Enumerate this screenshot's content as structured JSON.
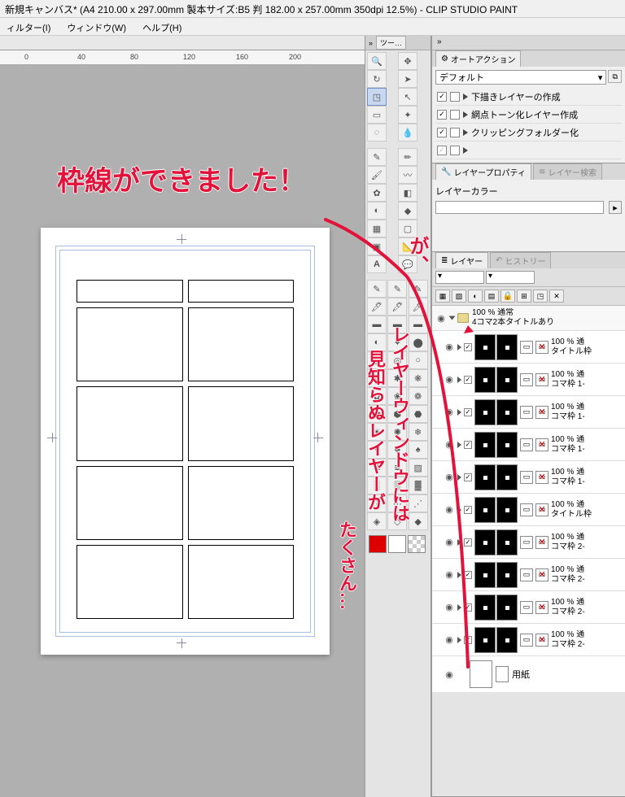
{
  "titlebar": "新規キャンバス* (A4 210.00 x 297.00mm 製本サイズ:B5 判 182.00 x 257.00mm 350dpi 12.5%)  - CLIP STUDIO PAINT",
  "menu": {
    "filter": "ィルター(I)",
    "window": "ウィンドウ(W)",
    "help": "ヘルプ(H)"
  },
  "ruler": [
    "0",
    "40",
    "80",
    "120",
    "160",
    "200"
  ],
  "tools_tab": "ツー…",
  "autoaction": {
    "tab": "オートアクション",
    "select": "デフォルト",
    "items": [
      "下描きレイヤーの作成",
      "網点トーン化レイヤー作成",
      "クリッピングフォルダー化",
      ""
    ]
  },
  "layerprop": {
    "tab": "レイヤープロパティ",
    "tab2": "レイヤー検索",
    "label": "レイヤーカラー"
  },
  "layerpanel": {
    "tab": "レイヤー",
    "tab2": "ヒストリー",
    "folder": {
      "opacity": "100 % 通常",
      "name": "4コマ2本タイトルあり"
    },
    "layers": [
      {
        "op": "100 % 通",
        "name": "タイトル枠"
      },
      {
        "op": "100 % 通",
        "name": "コマ枠 1-"
      },
      {
        "op": "100 % 通",
        "name": "コマ枠 1-"
      },
      {
        "op": "100 % 通",
        "name": "コマ枠 1-"
      },
      {
        "op": "100 % 通",
        "name": "コマ枠 1-"
      },
      {
        "op": "100 % 通",
        "name": "タイトル枠"
      },
      {
        "op": "100 % 通",
        "name": "コマ枠 2-"
      },
      {
        "op": "100 % 通",
        "name": "コマ枠 2-"
      },
      {
        "op": "100 % 通",
        "name": "コマ枠 2-"
      },
      {
        "op": "100 % 通",
        "name": "コマ枠 2-"
      }
    ],
    "paper": "用紙"
  },
  "annotations": {
    "a1": "枠線ができました！",
    "a2": "が、",
    "a3": "レイヤーウィンドウには",
    "a4": "見知らぬレイヤーが",
    "a5": "たくさん…"
  }
}
